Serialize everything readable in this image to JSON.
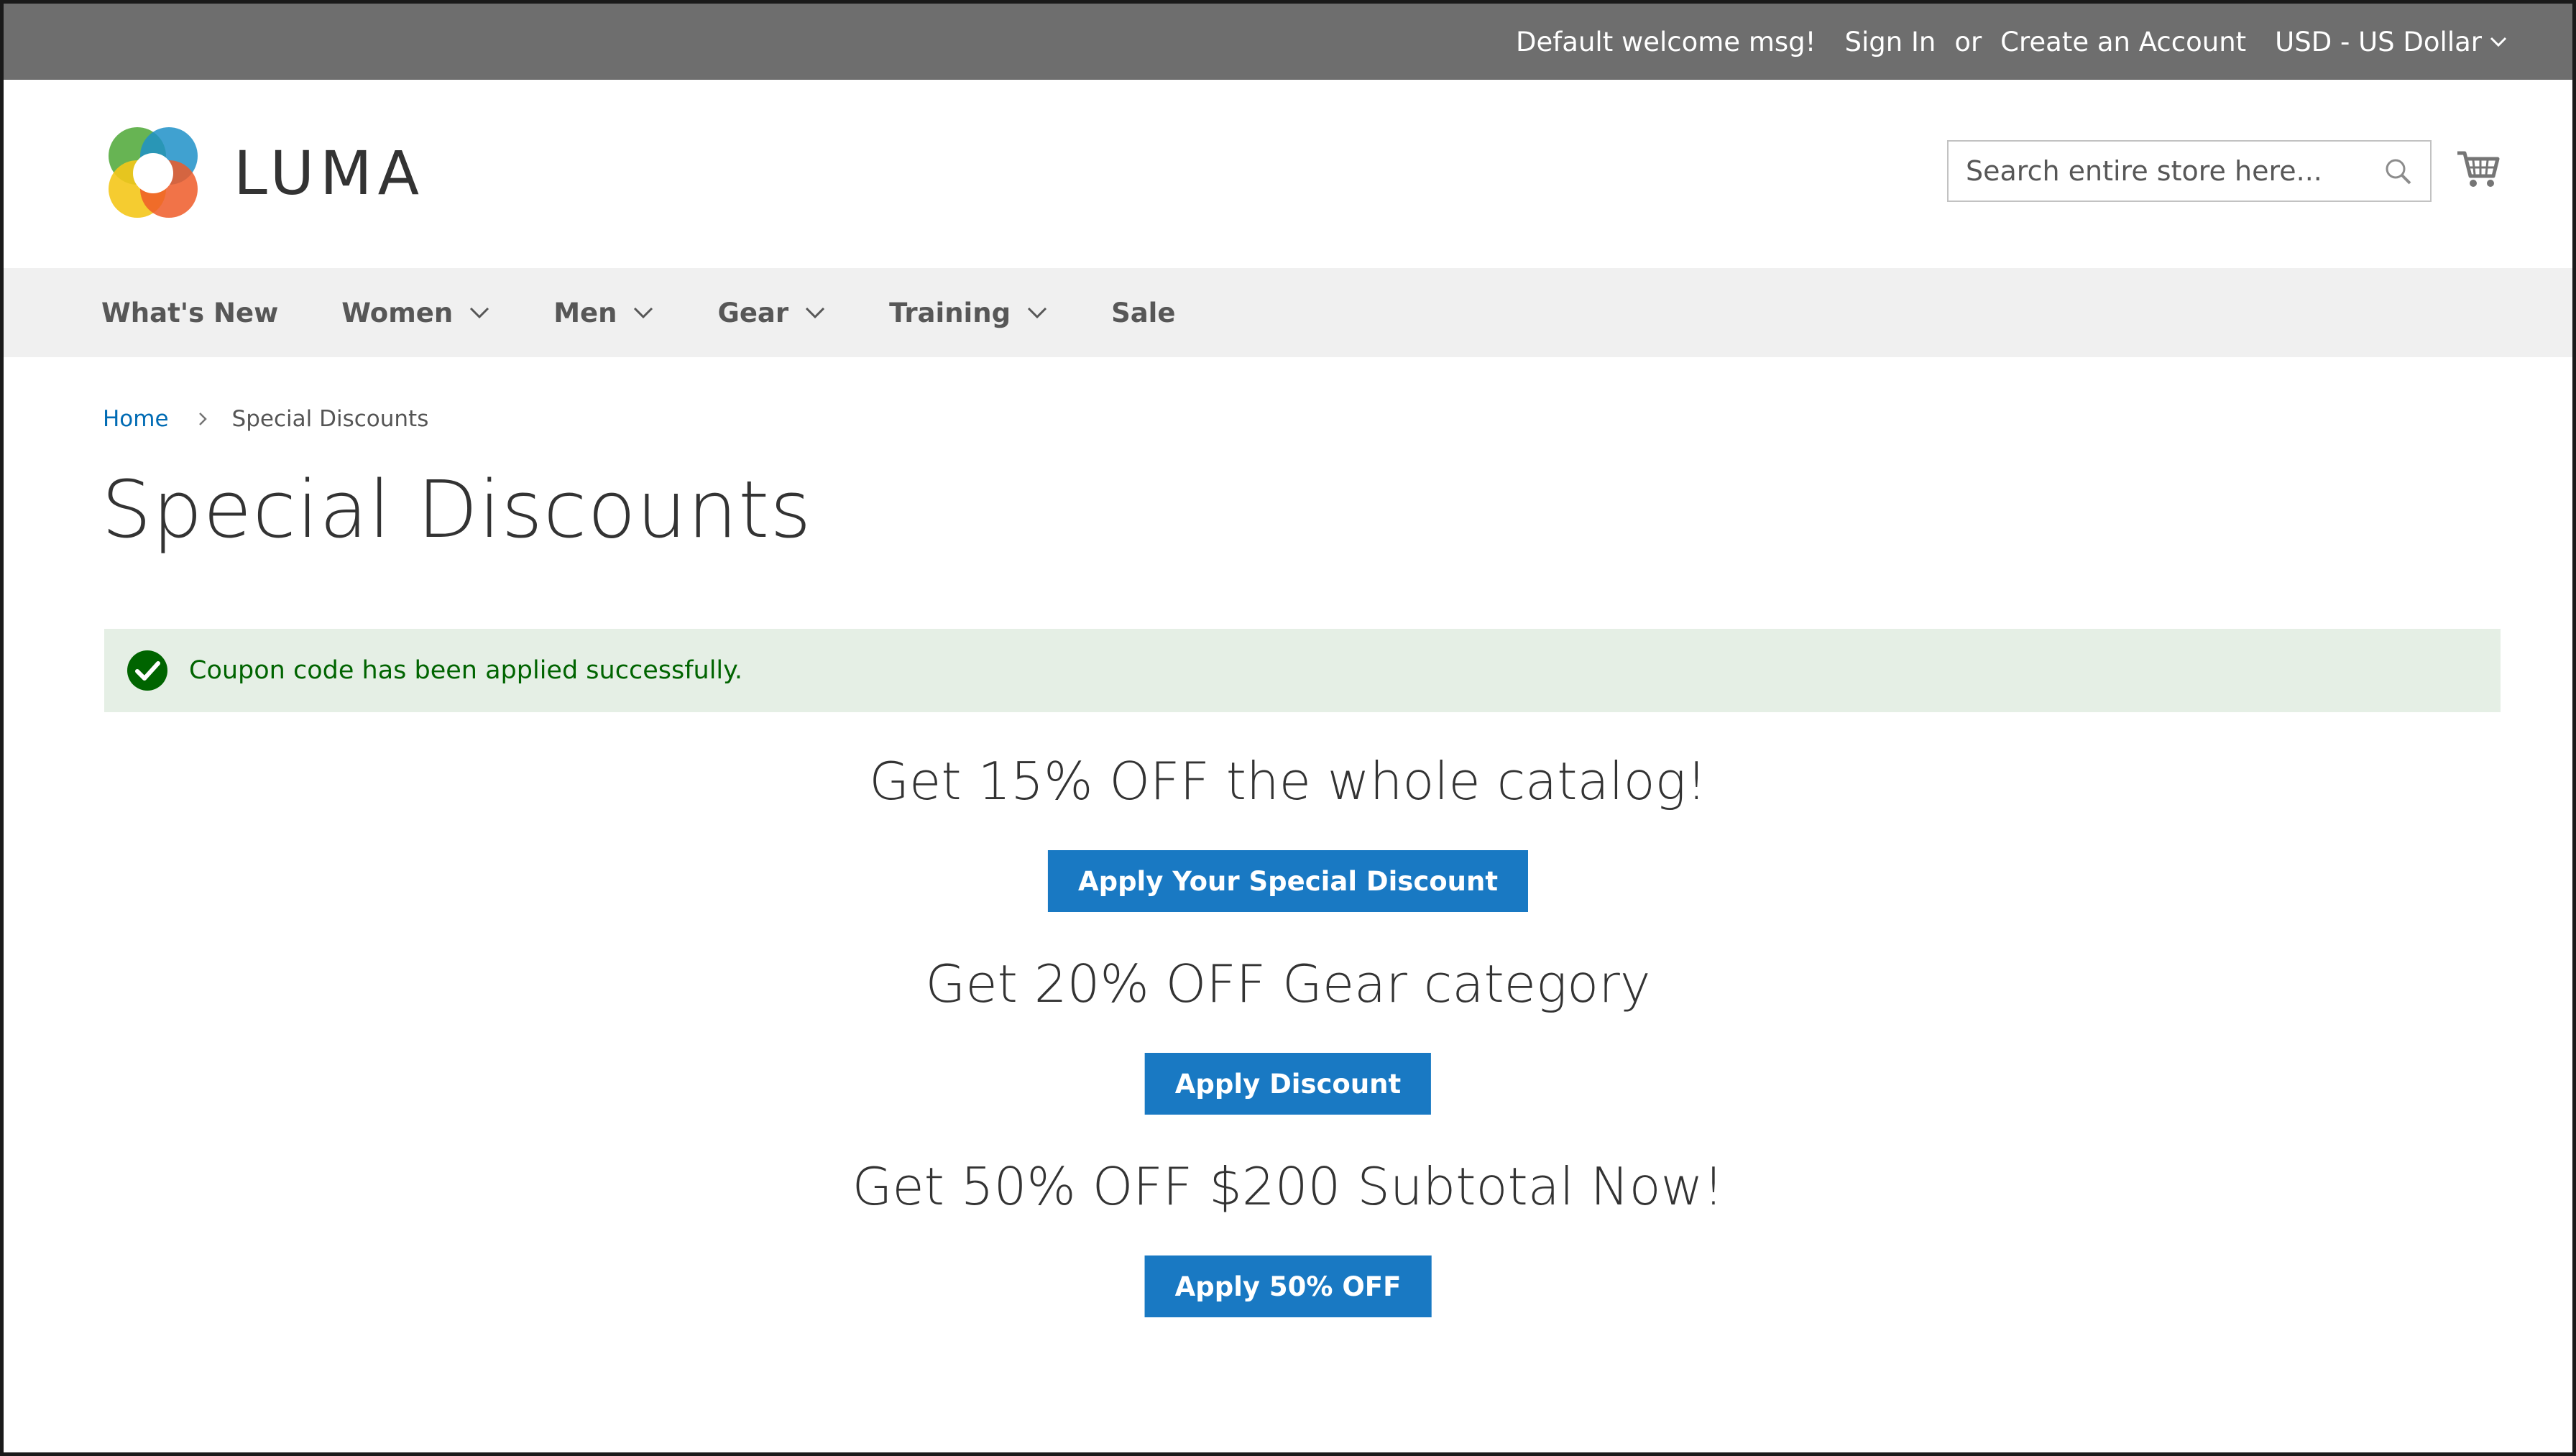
{
  "top_panel": {
    "welcome": "Default welcome msg!",
    "sign_in": "Sign In",
    "or": "or",
    "create_account": "Create an Account",
    "currency": "USD - US Dollar"
  },
  "header": {
    "logo_text": "LUMA",
    "search_placeholder": "Search entire store here...",
    "icons": {
      "search": "search-icon",
      "cart": "cart-icon"
    }
  },
  "nav": {
    "items": [
      {
        "label": "What's New",
        "has_dropdown": false
      },
      {
        "label": "Women",
        "has_dropdown": true
      },
      {
        "label": "Men",
        "has_dropdown": true
      },
      {
        "label": "Gear",
        "has_dropdown": true
      },
      {
        "label": "Training",
        "has_dropdown": true
      },
      {
        "label": "Sale",
        "has_dropdown": false
      }
    ]
  },
  "breadcrumb": {
    "home": "Home",
    "current": "Special Discounts"
  },
  "page_title": "Special Discounts",
  "message": {
    "text": "Coupon code has been applied successfully.",
    "type": "success",
    "icon": "check-circle-icon"
  },
  "offers": [
    {
      "title": "Get 15% OFF the whole catalog!",
      "button": "Apply Your Special Discount"
    },
    {
      "title": "Get 20% OFF Gear category",
      "button": "Apply Discount"
    },
    {
      "title": "Get 50% OFF $200 Subtotal Now!",
      "button": "Apply 50% OFF"
    }
  ],
  "colors": {
    "top_panel_bg": "#6e6e6e",
    "nav_bg": "#f0f0f0",
    "link": "#006bb4",
    "primary_button": "#1979c3",
    "success_bg": "#e5efe5",
    "success_text": "#006400"
  }
}
